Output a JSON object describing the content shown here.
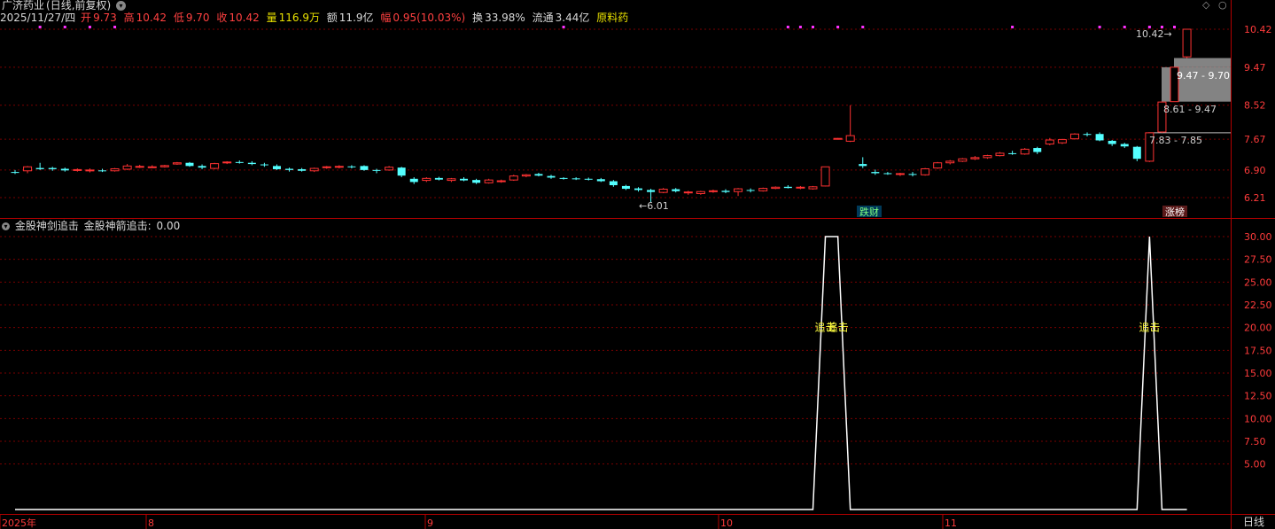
{
  "header": {
    "stock_name": "广济药业",
    "period": "(日线,前复权)",
    "date": "2025/11/27/四",
    "open_label": "开",
    "open": "9.73",
    "high_label": "高",
    "high": "10.42",
    "low_label": "低",
    "low": "9.70",
    "close_label": "收",
    "close": "10.42",
    "volume_label": "量",
    "volume": "116.9万",
    "amount_label": "额",
    "amount": "11.9亿",
    "change_label": "幅",
    "change": "0.95(10.03%)",
    "turnover_label": "换",
    "turnover": "33.98%",
    "float_label": "流通",
    "float": "3.44亿",
    "sector": "原料药",
    "expand_icon": "chevron-circle-down-icon"
  },
  "indicator": {
    "title": "金股神剑追击",
    "value_label": "金股神箭追击:",
    "value": "0.00",
    "signal_label": "追击"
  },
  "chart_data": [
    {
      "type": "candlestick",
      "title": "广济药业(日线,前复权)",
      "y_ticks": [
        10.42,
        9.47,
        8.52,
        7.67,
        6.9,
        6.21
      ],
      "ylim": [
        5.95,
        10.75
      ],
      "grid": true,
      "candles": [
        [
          6.85,
          6.9,
          6.8,
          6.84
        ],
        [
          6.88,
          7.0,
          6.82,
          6.98
        ],
        [
          6.95,
          7.08,
          6.9,
          6.92
        ],
        [
          6.95,
          6.98,
          6.88,
          6.92
        ],
        [
          6.93,
          6.96,
          6.86,
          6.89
        ],
        [
          6.9,
          6.94,
          6.86,
          6.91
        ],
        [
          6.88,
          6.94,
          6.84,
          6.9
        ],
        [
          6.89,
          6.93,
          6.85,
          6.87
        ],
        [
          6.88,
          6.95,
          6.86,
          6.93
        ],
        [
          6.92,
          7.05,
          6.9,
          7.0
        ],
        [
          6.98,
          7.03,
          6.95,
          6.99
        ],
        [
          6.97,
          7.02,
          6.95,
          6.98
        ],
        [
          6.98,
          7.03,
          6.96,
          7.01
        ],
        [
          7.05,
          7.1,
          7.03,
          7.08
        ],
        [
          7.08,
          7.1,
          6.98,
          7.0
        ],
        [
          7.0,
          7.04,
          6.92,
          6.96
        ],
        [
          6.94,
          7.08,
          6.92,
          7.06
        ],
        [
          7.08,
          7.12,
          7.05,
          7.1
        ],
        [
          7.1,
          7.14,
          7.06,
          7.08
        ],
        [
          7.08,
          7.12,
          7.02,
          7.05
        ],
        [
          7.04,
          7.08,
          6.98,
          7.02
        ],
        [
          7.0,
          7.04,
          6.9,
          6.92
        ],
        [
          6.93,
          6.96,
          6.86,
          6.9
        ],
        [
          6.92,
          6.95,
          6.86,
          6.88
        ],
        [
          6.88,
          6.96,
          6.85,
          6.94
        ],
        [
          6.96,
          7.0,
          6.93,
          6.98
        ],
        [
          6.97,
          7.02,
          6.94,
          6.99
        ],
        [
          6.99,
          7.02,
          6.94,
          6.98
        ],
        [
          7.0,
          7.02,
          6.88,
          6.9
        ],
        [
          6.9,
          6.93,
          6.82,
          6.88
        ],
        [
          6.9,
          7.0,
          6.88,
          6.97
        ],
        [
          6.96,
          6.98,
          6.72,
          6.76
        ],
        [
          6.68,
          6.72,
          6.55,
          6.6
        ],
        [
          6.64,
          6.72,
          6.6,
          6.69
        ],
        [
          6.7,
          6.73,
          6.64,
          6.66
        ],
        [
          6.64,
          6.7,
          6.6,
          6.68
        ],
        [
          6.68,
          6.72,
          6.62,
          6.64
        ],
        [
          6.65,
          6.68,
          6.55,
          6.58
        ],
        [
          6.58,
          6.68,
          6.56,
          6.65
        ],
        [
          6.62,
          6.66,
          6.58,
          6.63
        ],
        [
          6.65,
          6.78,
          6.63,
          6.75
        ],
        [
          6.75,
          6.8,
          6.72,
          6.78
        ],
        [
          6.8,
          6.83,
          6.74,
          6.76
        ],
        [
          6.75,
          6.78,
          6.68,
          6.71
        ],
        [
          6.7,
          6.72,
          6.66,
          6.69
        ],
        [
          6.69,
          6.72,
          6.65,
          6.68
        ],
        [
          6.68,
          6.71,
          6.64,
          6.67
        ],
        [
          6.67,
          6.7,
          6.6,
          6.62
        ],
        [
          6.62,
          6.65,
          6.48,
          6.52
        ],
        [
          6.5,
          6.53,
          6.4,
          6.43
        ],
        [
          6.44,
          6.47,
          6.36,
          6.4
        ],
        [
          6.4,
          6.43,
          6.1,
          6.35
        ],
        [
          6.34,
          6.45,
          6.32,
          6.42
        ],
        [
          6.42,
          6.45,
          6.34,
          6.37
        ],
        [
          6.33,
          6.38,
          6.28,
          6.35
        ],
        [
          6.31,
          6.38,
          6.28,
          6.36
        ],
        [
          6.37,
          6.41,
          6.33,
          6.38
        ],
        [
          6.38,
          6.42,
          6.32,
          6.35
        ],
        [
          6.36,
          6.45,
          6.25,
          6.43
        ],
        [
          6.4,
          6.44,
          6.34,
          6.38
        ],
        [
          6.38,
          6.46,
          6.36,
          6.44
        ],
        [
          6.44,
          6.49,
          6.42,
          6.47
        ],
        [
          6.48,
          6.52,
          6.44,
          6.45
        ],
        [
          6.46,
          6.5,
          6.42,
          6.47
        ],
        [
          6.43,
          6.5,
          6.41,
          6.48
        ],
        [
          6.5,
          6.98,
          6.49,
          6.98
        ],
        [
          7.69,
          7.7,
          7.68,
          7.69
        ],
        [
          7.62,
          8.52,
          7.6,
          7.76
        ],
        [
          7.05,
          7.22,
          6.95,
          7.0
        ],
        [
          6.85,
          6.91,
          6.78,
          6.82
        ],
        [
          6.82,
          6.85,
          6.78,
          6.8
        ],
        [
          6.79,
          6.83,
          6.75,
          6.81
        ],
        [
          6.8,
          6.85,
          6.74,
          6.78
        ],
        [
          6.78,
          6.95,
          6.76,
          6.93
        ],
        [
          6.95,
          7.1,
          6.93,
          7.08
        ],
        [
          7.08,
          7.15,
          7.04,
          7.12
        ],
        [
          7.12,
          7.2,
          7.1,
          7.18
        ],
        [
          7.18,
          7.25,
          7.15,
          7.21
        ],
        [
          7.21,
          7.28,
          7.18,
          7.26
        ],
        [
          7.26,
          7.35,
          7.24,
          7.32
        ],
        [
          7.32,
          7.38,
          7.28,
          7.3
        ],
        [
          7.3,
          7.45,
          7.28,
          7.42
        ],
        [
          7.45,
          7.48,
          7.3,
          7.35
        ],
        [
          7.55,
          7.7,
          7.52,
          7.65
        ],
        [
          7.58,
          7.68,
          7.55,
          7.66
        ],
        [
          7.68,
          7.82,
          7.66,
          7.8
        ],
        [
          7.8,
          7.84,
          7.74,
          7.79
        ],
        [
          7.8,
          7.84,
          7.62,
          7.64
        ],
        [
          7.63,
          7.65,
          7.5,
          7.55
        ],
        [
          7.55,
          7.58,
          7.45,
          7.49
        ],
        [
          7.48,
          7.5,
          7.12,
          7.18
        ],
        [
          7.12,
          7.83,
          7.1,
          7.83
        ],
        [
          7.85,
          8.61,
          7.83,
          8.6
        ],
        [
          8.61,
          9.47,
          8.61,
          9.47
        ],
        [
          9.73,
          10.42,
          9.7,
          10.42
        ]
      ],
      "annotations": {
        "low_label": "6.01",
        "high_label": "10.42",
        "gap_1": "7.83 - 7.85",
        "gap_2": "8.61 - 9.47",
        "gap_3": "9.47 - 9.70",
        "tag_1": "跌财",
        "tag_2": "涨榜"
      },
      "colors": {
        "up": "#ff3232",
        "down": "#54ffff",
        "grid": "#7a0000",
        "axis": "#b40000"
      }
    },
    {
      "type": "line",
      "title": "金股神剑追击",
      "series": [
        {
          "name": "金股神箭追击",
          "values": [
            0,
            0,
            0,
            0,
            0,
            0,
            0,
            0,
            0,
            0,
            0,
            0,
            0,
            0,
            0,
            0,
            0,
            0,
            0,
            0,
            0,
            0,
            0,
            0,
            0,
            0,
            0,
            0,
            0,
            0,
            0,
            0,
            0,
            0,
            0,
            0,
            0,
            0,
            0,
            0,
            0,
            0,
            0,
            0,
            0,
            0,
            0,
            0,
            0,
            0,
            0,
            0,
            0,
            0,
            0,
            0,
            0,
            0,
            0,
            0,
            0,
            0,
            0,
            0,
            0,
            30,
            30,
            0,
            0,
            0,
            0,
            0,
            0,
            0,
            0,
            0,
            0,
            0,
            0,
            0,
            0,
            0,
            0,
            0,
            0,
            0,
            0,
            0,
            0,
            0,
            0,
            30,
            0,
            0,
            0
          ]
        }
      ],
      "y_ticks": [
        "30.00",
        "27.50",
        "25.00",
        "22.50",
        "20.00",
        "17.50",
        "15.00",
        "12.50",
        "10.00",
        "7.50",
        "5.00"
      ],
      "ylim": [
        0,
        30
      ],
      "signal_positions": [
        65,
        91
      ]
    }
  ],
  "x_axis": {
    "labels": [
      "2025年",
      "8",
      "9",
      "10",
      "11"
    ]
  },
  "bottom_label": "日线",
  "toolbar": {
    "diamond_icon": "diamond-icon",
    "settings_icon": "circle-icon"
  },
  "dot_markers": [
    2,
    4,
    6,
    8,
    44,
    62,
    63,
    64,
    66,
    68,
    80,
    87,
    89,
    91,
    92,
    93
  ]
}
